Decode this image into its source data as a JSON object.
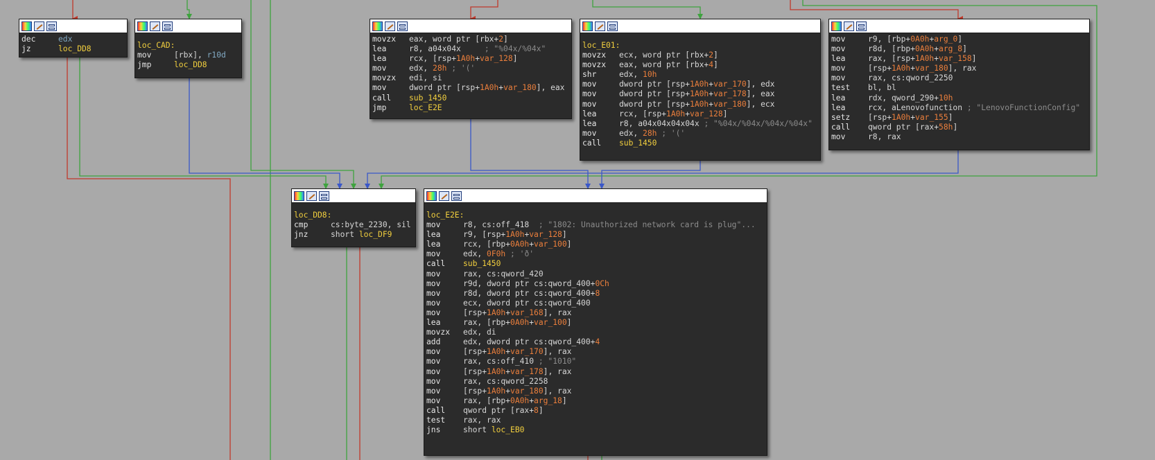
{
  "colors": {
    "background": "#a9a9a9",
    "block_bg": "#2b2b2b",
    "edge_red": "#c0392b",
    "edge_green": "#3ea33e",
    "edge_blue": "#3a57c8",
    "label_yellow": "#f2cf3e",
    "register_blue": "#82aac4",
    "number_orange": "#ec7f3c",
    "comment_gray": "#8c8c8c"
  },
  "header_icons": [
    "color-palette-icon",
    "edit-pencil-icon",
    "graph-toggle-icon"
  ],
  "blocks": [
    {
      "id": "block-dec",
      "label": "",
      "lines": [
        [
          {
            "t": "mn",
            "v": "dec"
          },
          {
            "t": "reg",
            "v": "edx"
          }
        ],
        [
          {
            "t": "mn",
            "v": "jz"
          },
          {
            "t": "name",
            "v": "loc_DD8"
          }
        ]
      ]
    },
    {
      "id": "block-loc-cad",
      "label": "loc_CAD:",
      "lines": [
        [
          {
            "t": "mn",
            "v": "mov"
          },
          {
            "t": "txt",
            "v": "[rbx], "
          },
          {
            "t": "reg",
            "v": "r10d"
          }
        ],
        [
          {
            "t": "mn",
            "v": "jmp"
          },
          {
            "t": "name",
            "v": "loc_DD8"
          }
        ]
      ]
    },
    {
      "id": "block-movzx",
      "label": "",
      "lines": [
        [
          {
            "t": "mn",
            "v": "movzx"
          },
          {
            "t": "txt",
            "v": "eax, word ptr [rbx+"
          },
          {
            "t": "num",
            "v": "2"
          },
          {
            "t": "txt",
            "v": "]"
          }
        ],
        [
          {
            "t": "mn",
            "v": "lea"
          },
          {
            "t": "txt",
            "v": "r8, a04x04x     "
          },
          {
            "t": "cmt",
            "v": "; \"%04x/%04x\""
          }
        ],
        [
          {
            "t": "mn",
            "v": "lea"
          },
          {
            "t": "txt",
            "v": "rcx, [rsp+"
          },
          {
            "t": "var",
            "v": "1A0h"
          },
          {
            "t": "txt",
            "v": "+"
          },
          {
            "t": "var",
            "v": "var_128"
          },
          {
            "t": "txt",
            "v": "]"
          }
        ],
        [
          {
            "t": "mn",
            "v": "mov"
          },
          {
            "t": "txt",
            "v": "edx, "
          },
          {
            "t": "num",
            "v": "28h"
          },
          {
            "t": "cmt",
            "v": " ; '('"
          }
        ],
        [
          {
            "t": "mn",
            "v": "movzx"
          },
          {
            "t": "txt",
            "v": "edi, si"
          }
        ],
        [
          {
            "t": "mn",
            "v": "mov"
          },
          {
            "t": "txt",
            "v": "dword ptr [rsp+"
          },
          {
            "t": "var",
            "v": "1A0h"
          },
          {
            "t": "txt",
            "v": "+"
          },
          {
            "t": "var",
            "v": "var_180"
          },
          {
            "t": "txt",
            "v": "], eax"
          }
        ],
        [
          {
            "t": "mn",
            "v": "call"
          },
          {
            "t": "name",
            "v": "sub_1450"
          }
        ],
        [
          {
            "t": "mn",
            "v": "jmp"
          },
          {
            "t": "name",
            "v": "loc_E2E"
          }
        ]
      ]
    },
    {
      "id": "block-loc-e01",
      "label": "loc_E01:",
      "lines": [
        [
          {
            "t": "mn",
            "v": "movzx"
          },
          {
            "t": "txt",
            "v": "ecx, word ptr [rbx+"
          },
          {
            "t": "num",
            "v": "2"
          },
          {
            "t": "txt",
            "v": "]"
          }
        ],
        [
          {
            "t": "mn",
            "v": "movzx"
          },
          {
            "t": "txt",
            "v": "eax, word ptr [rbx+"
          },
          {
            "t": "num",
            "v": "4"
          },
          {
            "t": "txt",
            "v": "]"
          }
        ],
        [
          {
            "t": "mn",
            "v": "shr"
          },
          {
            "t": "txt",
            "v": "edx, "
          },
          {
            "t": "num",
            "v": "10h"
          }
        ],
        [
          {
            "t": "mn",
            "v": "mov"
          },
          {
            "t": "txt",
            "v": "dword ptr [rsp+"
          },
          {
            "t": "var",
            "v": "1A0h"
          },
          {
            "t": "txt",
            "v": "+"
          },
          {
            "t": "var",
            "v": "var_170"
          },
          {
            "t": "txt",
            "v": "], edx"
          }
        ],
        [
          {
            "t": "mn",
            "v": "mov"
          },
          {
            "t": "txt",
            "v": "dword ptr [rsp+"
          },
          {
            "t": "var",
            "v": "1A0h"
          },
          {
            "t": "txt",
            "v": "+"
          },
          {
            "t": "var",
            "v": "var_178"
          },
          {
            "t": "txt",
            "v": "], eax"
          }
        ],
        [
          {
            "t": "mn",
            "v": "mov"
          },
          {
            "t": "txt",
            "v": "dword ptr [rsp+"
          },
          {
            "t": "var",
            "v": "1A0h"
          },
          {
            "t": "txt",
            "v": "+"
          },
          {
            "t": "var",
            "v": "var_180"
          },
          {
            "t": "txt",
            "v": "], ecx"
          }
        ],
        [
          {
            "t": "mn",
            "v": "lea"
          },
          {
            "t": "txt",
            "v": "rcx, [rsp+"
          },
          {
            "t": "var",
            "v": "1A0h"
          },
          {
            "t": "txt",
            "v": "+"
          },
          {
            "t": "var",
            "v": "var_128"
          },
          {
            "t": "txt",
            "v": "]"
          }
        ],
        [
          {
            "t": "mn",
            "v": "lea"
          },
          {
            "t": "txt",
            "v": "r8, a04x04x04x04x "
          },
          {
            "t": "cmt",
            "v": "; \"%04x/%04x/%04x/%04x\""
          }
        ],
        [
          {
            "t": "mn",
            "v": "mov"
          },
          {
            "t": "txt",
            "v": "edx, "
          },
          {
            "t": "num",
            "v": "28h"
          },
          {
            "t": "cmt",
            "v": " ; '('"
          }
        ],
        [
          {
            "t": "mn",
            "v": "call"
          },
          {
            "t": "name",
            "v": "sub_1450"
          }
        ]
      ]
    },
    {
      "id": "block-r9",
      "label": "",
      "lines": [
        [
          {
            "t": "mn",
            "v": "mov"
          },
          {
            "t": "txt",
            "v": "r9, [rbp+"
          },
          {
            "t": "var",
            "v": "0A0h"
          },
          {
            "t": "txt",
            "v": "+"
          },
          {
            "t": "var",
            "v": "arg_0"
          },
          {
            "t": "txt",
            "v": "]"
          }
        ],
        [
          {
            "t": "mn",
            "v": "mov"
          },
          {
            "t": "txt",
            "v": "r8d, [rbp+"
          },
          {
            "t": "var",
            "v": "0A0h"
          },
          {
            "t": "txt",
            "v": "+"
          },
          {
            "t": "var",
            "v": "arg_8"
          },
          {
            "t": "txt",
            "v": "]"
          }
        ],
        [
          {
            "t": "mn",
            "v": "lea"
          },
          {
            "t": "txt",
            "v": "rax, [rsp+"
          },
          {
            "t": "var",
            "v": "1A0h"
          },
          {
            "t": "txt",
            "v": "+"
          },
          {
            "t": "var",
            "v": "var_158"
          },
          {
            "t": "txt",
            "v": "]"
          }
        ],
        [
          {
            "t": "mn",
            "v": "mov"
          },
          {
            "t": "txt",
            "v": "[rsp+"
          },
          {
            "t": "var",
            "v": "1A0h"
          },
          {
            "t": "txt",
            "v": "+"
          },
          {
            "t": "var",
            "v": "var_180"
          },
          {
            "t": "txt",
            "v": "], rax"
          }
        ],
        [
          {
            "t": "mn",
            "v": "mov"
          },
          {
            "t": "txt",
            "v": "rax, cs:qword_2250"
          }
        ],
        [
          {
            "t": "mn",
            "v": "test"
          },
          {
            "t": "txt",
            "v": "bl, bl"
          }
        ],
        [
          {
            "t": "mn",
            "v": "lea"
          },
          {
            "t": "txt",
            "v": "rdx, qword_290+"
          },
          {
            "t": "num",
            "v": "10h"
          }
        ],
        [
          {
            "t": "mn",
            "v": "lea"
          },
          {
            "t": "txt",
            "v": "rcx, aLenovofunction "
          },
          {
            "t": "cmt",
            "v": "; \"LenovoFunctionConfig\""
          }
        ],
        [
          {
            "t": "mn",
            "v": "setz"
          },
          {
            "t": "txt",
            "v": "[rsp+"
          },
          {
            "t": "var",
            "v": "1A0h"
          },
          {
            "t": "txt",
            "v": "+"
          },
          {
            "t": "var",
            "v": "var_155"
          },
          {
            "t": "txt",
            "v": "]"
          }
        ],
        [
          {
            "t": "mn",
            "v": "call"
          },
          {
            "t": "txt",
            "v": "qword ptr [rax+"
          },
          {
            "t": "num",
            "v": "58h"
          },
          {
            "t": "txt",
            "v": "]"
          }
        ],
        [
          {
            "t": "mn",
            "v": "mov"
          },
          {
            "t": "txt",
            "v": "r8, rax"
          }
        ]
      ]
    },
    {
      "id": "block-loc-dd8",
      "label": "loc_DD8:",
      "lines": [
        [
          {
            "t": "mn",
            "v": "cmp"
          },
          {
            "t": "txt",
            "v": "cs:byte_2230, sil"
          }
        ],
        [
          {
            "t": "mn",
            "v": "jnz"
          },
          {
            "t": "txt",
            "v": "short "
          },
          {
            "t": "name",
            "v": "loc_DF9"
          }
        ]
      ]
    },
    {
      "id": "block-loc-e2e",
      "label": "loc_E2E:",
      "lines": [
        [
          {
            "t": "mn",
            "v": "mov"
          },
          {
            "t": "txt",
            "v": "r8, cs:off_418  "
          },
          {
            "t": "cmt",
            "v": "; \"1802: Unauthorized network card is plug\"..."
          }
        ],
        [
          {
            "t": "mn",
            "v": "lea"
          },
          {
            "t": "txt",
            "v": "r9, [rsp+"
          },
          {
            "t": "var",
            "v": "1A0h"
          },
          {
            "t": "txt",
            "v": "+"
          },
          {
            "t": "var",
            "v": "var_128"
          },
          {
            "t": "txt",
            "v": "]"
          }
        ],
        [
          {
            "t": "mn",
            "v": "lea"
          },
          {
            "t": "txt",
            "v": "rcx, [rbp+"
          },
          {
            "t": "var",
            "v": "0A0h"
          },
          {
            "t": "txt",
            "v": "+"
          },
          {
            "t": "var",
            "v": "var_100"
          },
          {
            "t": "txt",
            "v": "]"
          }
        ],
        [
          {
            "t": "mn",
            "v": "mov"
          },
          {
            "t": "txt",
            "v": "edx, "
          },
          {
            "t": "num",
            "v": "0F0h"
          },
          {
            "t": "cmt",
            "v": " ; 'ð'"
          }
        ],
        [
          {
            "t": "mn",
            "v": "call"
          },
          {
            "t": "name",
            "v": "sub_1450"
          }
        ],
        [
          {
            "t": "mn",
            "v": "mov"
          },
          {
            "t": "txt",
            "v": "rax, cs:qword_420"
          }
        ],
        [
          {
            "t": "mn",
            "v": "mov"
          },
          {
            "t": "txt",
            "v": "r9d, dword ptr cs:qword_400+"
          },
          {
            "t": "num",
            "v": "0Ch"
          }
        ],
        [
          {
            "t": "mn",
            "v": "mov"
          },
          {
            "t": "txt",
            "v": "r8d, dword ptr cs:qword_400+"
          },
          {
            "t": "num",
            "v": "8"
          }
        ],
        [
          {
            "t": "mn",
            "v": "mov"
          },
          {
            "t": "txt",
            "v": "ecx, dword ptr cs:qword_400"
          }
        ],
        [
          {
            "t": "mn",
            "v": "mov"
          },
          {
            "t": "txt",
            "v": "[rsp+"
          },
          {
            "t": "var",
            "v": "1A0h"
          },
          {
            "t": "txt",
            "v": "+"
          },
          {
            "t": "var",
            "v": "var_168"
          },
          {
            "t": "txt",
            "v": "], rax"
          }
        ],
        [
          {
            "t": "mn",
            "v": "lea"
          },
          {
            "t": "txt",
            "v": "rax, [rbp+"
          },
          {
            "t": "var",
            "v": "0A0h"
          },
          {
            "t": "txt",
            "v": "+"
          },
          {
            "t": "var",
            "v": "var_100"
          },
          {
            "t": "txt",
            "v": "]"
          }
        ],
        [
          {
            "t": "mn",
            "v": "movzx"
          },
          {
            "t": "txt",
            "v": "edx, di"
          }
        ],
        [
          {
            "t": "mn",
            "v": "add"
          },
          {
            "t": "txt",
            "v": "edx, dword ptr cs:qword_400+"
          },
          {
            "t": "num",
            "v": "4"
          }
        ],
        [
          {
            "t": "mn",
            "v": "mov"
          },
          {
            "t": "txt",
            "v": "[rsp+"
          },
          {
            "t": "var",
            "v": "1A0h"
          },
          {
            "t": "txt",
            "v": "+"
          },
          {
            "t": "var",
            "v": "var_170"
          },
          {
            "t": "txt",
            "v": "], rax"
          }
        ],
        [
          {
            "t": "mn",
            "v": "mov"
          },
          {
            "t": "txt",
            "v": "rax, cs:off_410 "
          },
          {
            "t": "cmt",
            "v": "; \"1010\""
          }
        ],
        [
          {
            "t": "mn",
            "v": "mov"
          },
          {
            "t": "txt",
            "v": "[rsp+"
          },
          {
            "t": "var",
            "v": "1A0h"
          },
          {
            "t": "txt",
            "v": "+"
          },
          {
            "t": "var",
            "v": "var_178"
          },
          {
            "t": "txt",
            "v": "], rax"
          }
        ],
        [
          {
            "t": "mn",
            "v": "mov"
          },
          {
            "t": "txt",
            "v": "rax, cs:qword_2258"
          }
        ],
        [
          {
            "t": "mn",
            "v": "mov"
          },
          {
            "t": "txt",
            "v": "[rsp+"
          },
          {
            "t": "var",
            "v": "1A0h"
          },
          {
            "t": "txt",
            "v": "+"
          },
          {
            "t": "var",
            "v": "var_180"
          },
          {
            "t": "txt",
            "v": "], rax"
          }
        ],
        [
          {
            "t": "mn",
            "v": "mov"
          },
          {
            "t": "txt",
            "v": "rax, [rbp+"
          },
          {
            "t": "var",
            "v": "0A0h"
          },
          {
            "t": "txt",
            "v": "+"
          },
          {
            "t": "var",
            "v": "arg_18"
          },
          {
            "t": "txt",
            "v": "]"
          }
        ],
        [
          {
            "t": "mn",
            "v": "call"
          },
          {
            "t": "txt",
            "v": "qword ptr [rax+"
          },
          {
            "t": "num",
            "v": "8"
          },
          {
            "t": "txt",
            "v": "]"
          }
        ],
        [
          {
            "t": "mn",
            "v": "test"
          },
          {
            "t": "txt",
            "v": "rax, rax"
          }
        ],
        [
          {
            "t": "mn",
            "v": "jns"
          },
          {
            "t": "txt",
            "v": "short "
          },
          {
            "t": "name",
            "v": "loc_EB0"
          }
        ]
      ]
    }
  ]
}
